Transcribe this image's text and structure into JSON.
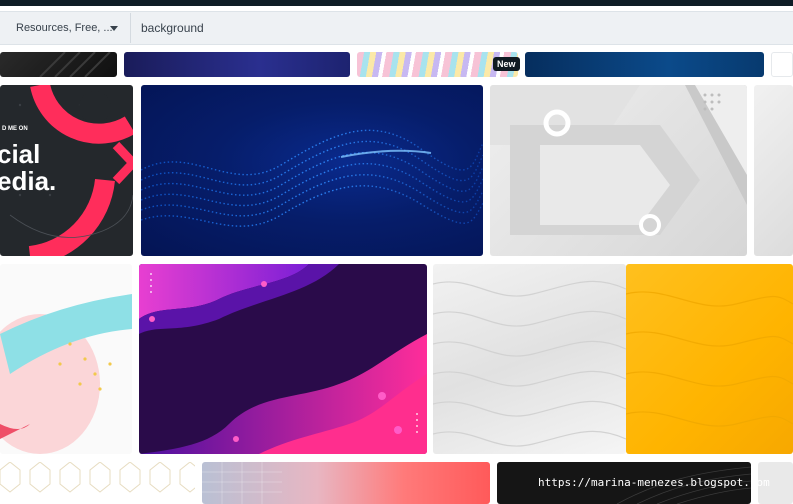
{
  "search": {
    "filter_label": "Resources, Free, ...",
    "query": "background"
  },
  "badges": {
    "new": "New"
  },
  "tiles": {
    "social_media": {
      "line1": "D ME ON",
      "line2": "cial",
      "line3": "edia."
    }
  },
  "watermark": "https://marina-menezes.blogspot.com",
  "colors": {
    "topbar": "#0e1d26",
    "search_bg": "#eef1f4",
    "badge_bg": "#101a22"
  },
  "icons": {
    "filter_dropdown": "chevron-down-icon"
  }
}
